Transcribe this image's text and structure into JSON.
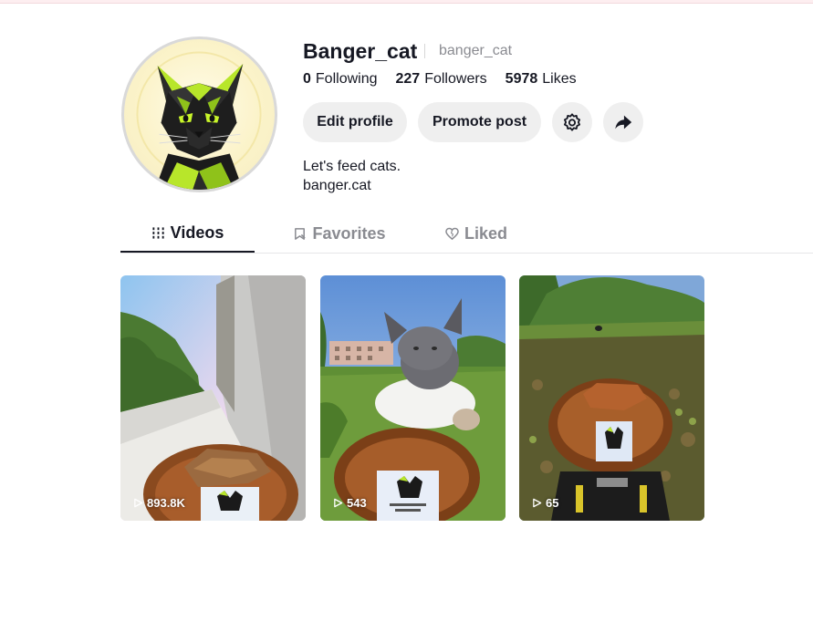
{
  "profile": {
    "username": "Banger_cat",
    "handle": "banger_cat",
    "bio_line1": "Let's feed cats.",
    "bio_line2": "banger.cat"
  },
  "stats": {
    "following_count": "0",
    "following_label": "Following",
    "followers_count": "227",
    "followers_label": "Followers",
    "likes_count": "5978",
    "likes_label": "Likes"
  },
  "actions": {
    "edit_profile": "Edit profile",
    "promote_post": "Promote post",
    "settings_icon": "gear-icon",
    "share_icon": "share-arrow-icon"
  },
  "tabs": [
    {
      "label": "Videos",
      "icon": "grid-bars-icon",
      "active": true
    },
    {
      "label": "Favorites",
      "icon": "bookmark-icon",
      "active": false
    },
    {
      "label": "Liked",
      "icon": "heart-icon",
      "active": false
    }
  ],
  "videos": [
    {
      "views": "893.8K"
    },
    {
      "views": "543"
    },
    {
      "views": "65"
    }
  ],
  "colors": {
    "text_primary": "#161823",
    "text_secondary": "#8a8b91",
    "button_bg": "#efefef",
    "accent_green": "#b8e62a"
  }
}
